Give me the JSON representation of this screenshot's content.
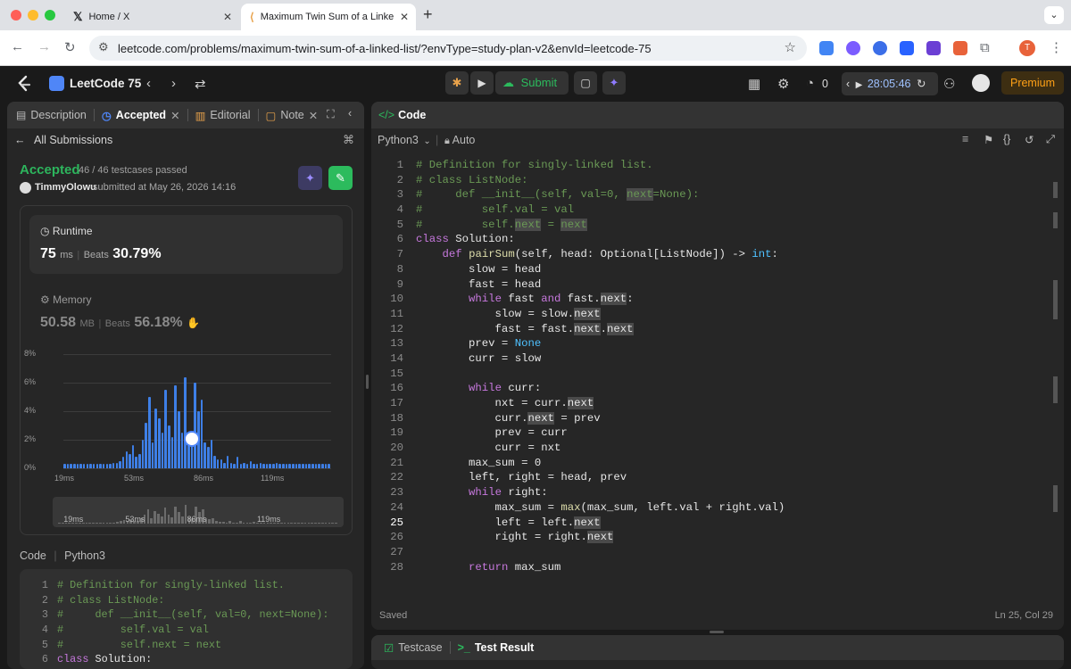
{
  "browser": {
    "tabs": [
      {
        "label": "Home / X",
        "icon": "x-logo-icon"
      },
      {
        "label": "Maximum Twin Sum of a Linke",
        "icon": "leetcode-favicon-icon"
      }
    ],
    "new_tab": "+",
    "url": "leetcode.com/problems/maximum-twin-sum-of-a-linked-list/?envType=study-plan-v2&envId=leetcode-75",
    "profile_initial": "T"
  },
  "topnav": {
    "study_plan": "LeetCode 75",
    "submit_label": "Submit",
    "fire_count": "0",
    "timer": "28:05:46",
    "premium_label": "Premium"
  },
  "left_panel": {
    "tabs": [
      "Description",
      "Accepted",
      "Editorial",
      "Note"
    ],
    "back_label": "All Submissions",
    "status": "Accepted",
    "testcases": "46 / 46 testcases passed",
    "user": "TimmyOlowu",
    "submitted_at": "submitted at May 26, 2026 14:16",
    "runtime": {
      "label": "Runtime",
      "value": "75",
      "unit": "ms",
      "beats_label": "Beats",
      "beats": "30.79%"
    },
    "memory": {
      "label": "Memory",
      "value": "50.58",
      "unit": "MB",
      "beats_label": "Beats",
      "beats": "56.18%"
    },
    "code_label": "Code",
    "code_lang": "Python3"
  },
  "chart_data": {
    "type": "bar",
    "ytick_labels": [
      "8%",
      "6%",
      "4%",
      "2%",
      "0%"
    ],
    "xtick_labels": [
      "19ms",
      "53ms",
      "86ms",
      "119ms"
    ],
    "ylim": [
      0,
      8
    ],
    "values": [
      0.3,
      0.3,
      0.3,
      0.3,
      0.3,
      0.3,
      0.3,
      0.3,
      0.3,
      0.3,
      0.3,
      0.3,
      0.3,
      0.3,
      0.3,
      0.4,
      0.4,
      0.5,
      0.8,
      1.2,
      1.0,
      1.6,
      0.8,
      1.0,
      2.0,
      3.2,
      5.0,
      1.8,
      4.2,
      3.5,
      2.5,
      5.5,
      3.0,
      2.2,
      5.8,
      4.0,
      2.5,
      6.4,
      2.2,
      2.0,
      6.0,
      4.0,
      4.8,
      1.8,
      1.5,
      2.0,
      0.9,
      0.6,
      0.6,
      0.4,
      0.9,
      0.4,
      0.3,
      0.8,
      0.3,
      0.4,
      0.3,
      0.5,
      0.3,
      0.3,
      0.4,
      0.3,
      0.3,
      0.3,
      0.3,
      0.4,
      0.3,
      0.3,
      0.3,
      0.3,
      0.3,
      0.3,
      0.3,
      0.3,
      0.3,
      0.3,
      0.3,
      0.3,
      0.3,
      0.3,
      0.3,
      0.3
    ],
    "marker_index": 39
  },
  "editor": {
    "header": "Code",
    "language": "Python3",
    "mode": "Auto",
    "status_left": "Saved",
    "status_right": "Ln 25, Col 29",
    "lines": [
      "# Definition for singly-linked list.",
      "# class ListNode:",
      "#     def __init__(self, val=0, next=None):",
      "#         self.val = val",
      "#         self.next = next",
      "class Solution:",
      "    def pairSum(self, head: Optional[ListNode]) -> int:",
      "        slow = head",
      "        fast = head",
      "        while fast and fast.next:",
      "            slow = slow.next",
      "            fast = fast.next.next",
      "        prev = None",
      "        curr = slow",
      "",
      "        while curr:",
      "            nxt = curr.next",
      "            curr.next = prev",
      "            prev = curr",
      "            curr = nxt",
      "        max_sum = 0",
      "        left, right = head, prev",
      "        while right:",
      "            max_sum = max(max_sum, left.val + right.val)",
      "            left = left.next",
      "            right = right.next",
      "",
      "        return max_sum"
    ]
  },
  "left_code_preview": [
    "# Definition for singly-linked list.",
    "# class ListNode:",
    "#     def __init__(self, val=0, next=None):",
    "#         self.val = val",
    "#         self.next = next",
    "class Solution:"
  ],
  "bottom_panel": {
    "testcase_label": "Testcase",
    "result_label": "Test Result"
  },
  "colors": {
    "accent_green": "#2cbb5d",
    "accepted_green": "#2db55d",
    "bar_blue": "#3e7fe6",
    "premium_orange": "#ffa116"
  }
}
